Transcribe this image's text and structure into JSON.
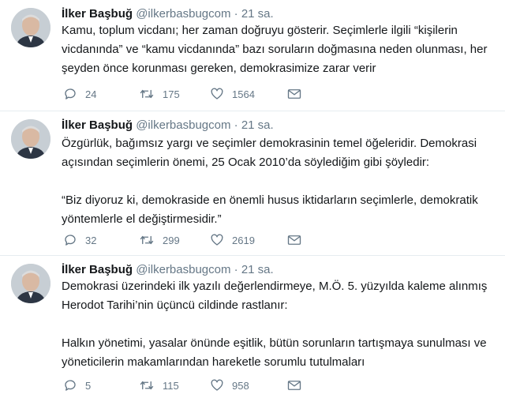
{
  "tweets": [
    {
      "name": "İlker Başbuğ",
      "handle": "@ilkerbasbugcom",
      "dot": "·",
      "time": "21 sa.",
      "text": "Kamu, toplum vicdanı; her zaman doğruyu gösterir. Seçimlerle ilgili “kişilerin vicdanında” ve “kamu vicdanında” bazı soruların doğmasına neden olunması, her şeyden önce korunması gereken, demokrasimize zarar verir",
      "replies": "24",
      "retweets": "175",
      "likes": "1564"
    },
    {
      "name": "İlker Başbuğ",
      "handle": "@ilkerbasbugcom",
      "dot": "·",
      "time": "21 sa.",
      "text": "Özgürlük, bağımsız yargı ve seçimler demokrasinin temel öğeleridir. Demokrasi açısından seçimlerin önemi, 25 Ocak 2010’da söylediğim gibi şöyledir:\n\n“Biz diyoruz ki, demokraside en önemli husus iktidarların seçimlerle, demokratik yöntemlerle el değiştirmesidir.”",
      "replies": "32",
      "retweets": "299",
      "likes": "2619"
    },
    {
      "name": "İlker Başbuğ",
      "handle": "@ilkerbasbugcom",
      "dot": "·",
      "time": "21 sa.",
      "text": "Demokrasi üzerindeki ilk yazılı değerlendirmeye, M.Ö. 5. yüzyılda kaleme alınmış Herodot Tarihi’nin üçüncü cildinde rastlanır:\n\nHalkın yönetimi, yasalar önünde eşitlik, bütün sorunların tartışmaya sunulması ve yöneticilerin makamlarından hareketle sorumlu tutulmaları",
      "replies": "5",
      "retweets": "115",
      "likes": "958"
    }
  ],
  "icons": [
    "avatar",
    "reply-icon",
    "retweet-icon",
    "like-icon",
    "message-icon"
  ]
}
